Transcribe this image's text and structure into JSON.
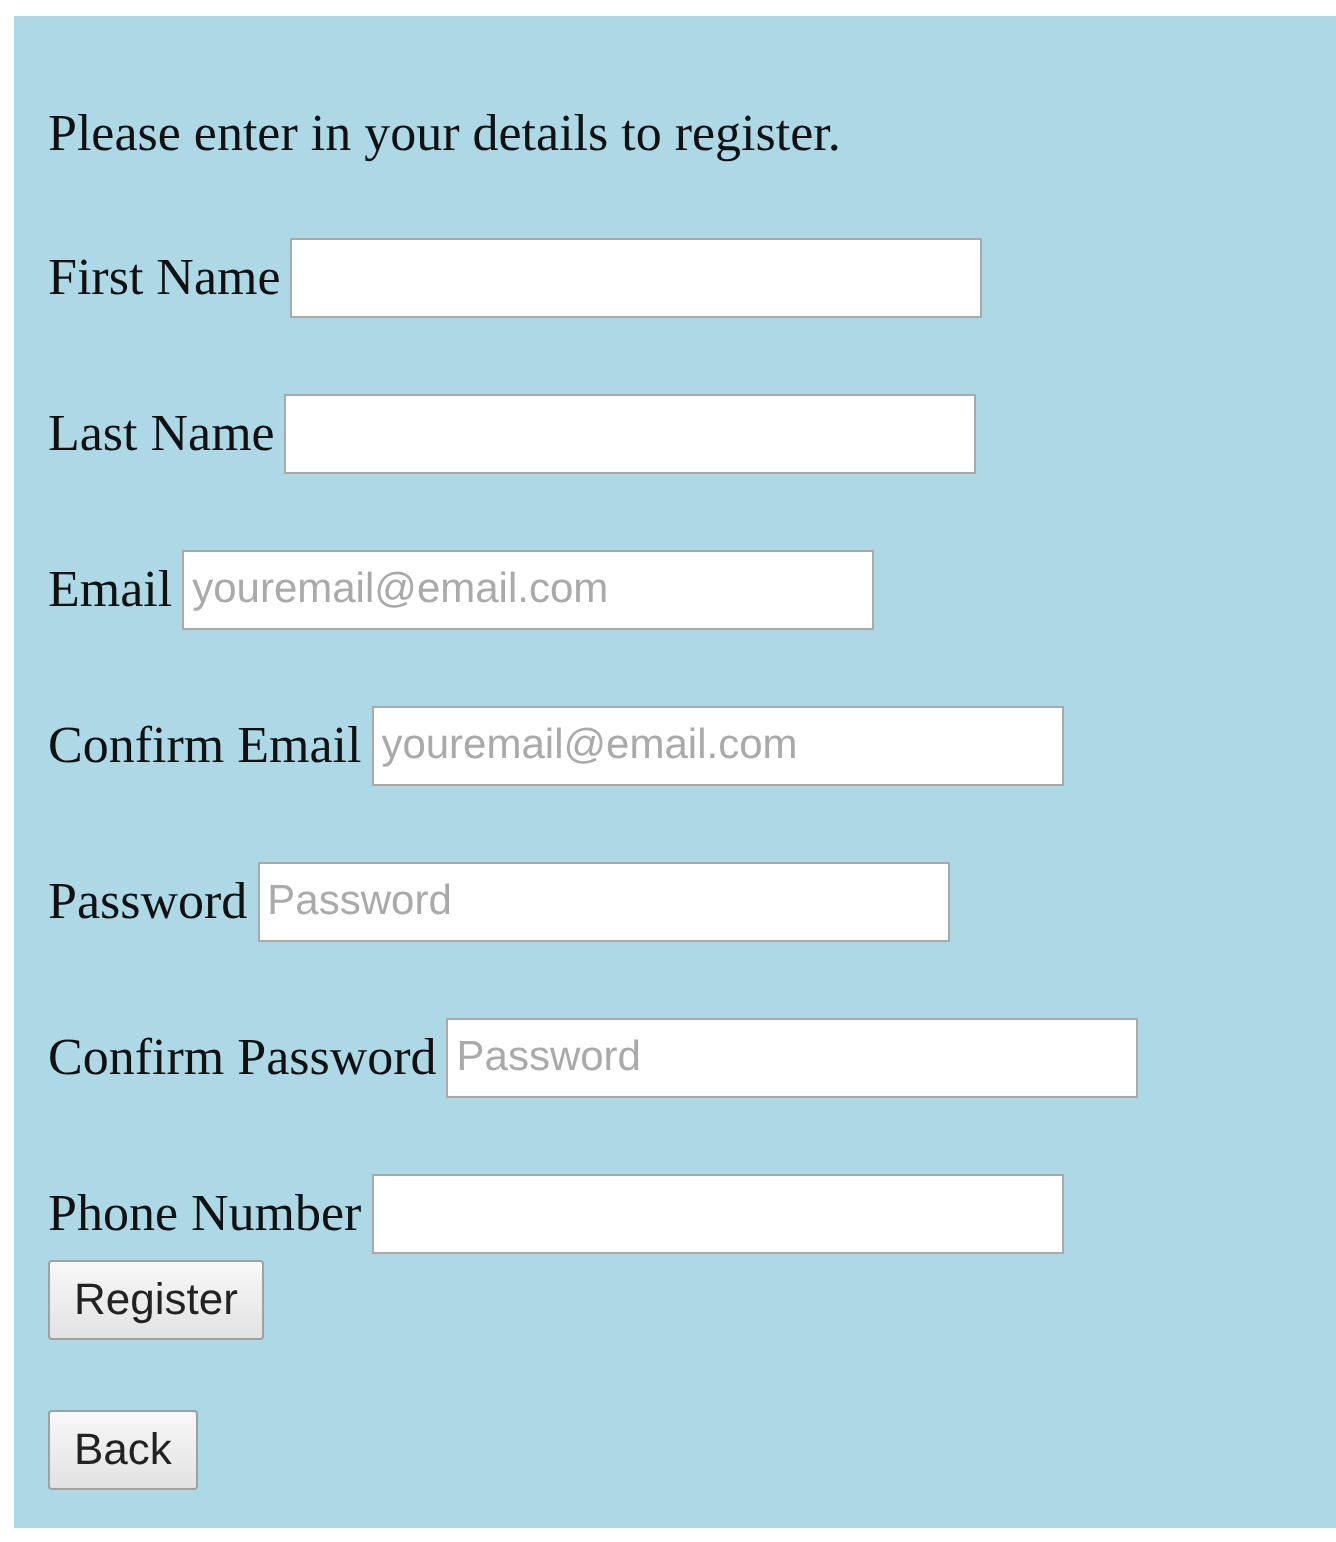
{
  "intro": "Please enter in your details to register.",
  "fields": [
    {
      "label": "First Name"
    },
    {
      "label": "Last Name"
    },
    {
      "label": "Email",
      "placeholder": "youremail@email.com"
    },
    {
      "label": "Confirm Email",
      "placeholder": "youremail@email.com"
    },
    {
      "label": "Password",
      "placeholder": "Password"
    },
    {
      "label": "Confirm Password",
      "placeholder": "Password"
    },
    {
      "label": "Phone Number"
    }
  ],
  "register_button": "Register",
  "back_button": "Back"
}
